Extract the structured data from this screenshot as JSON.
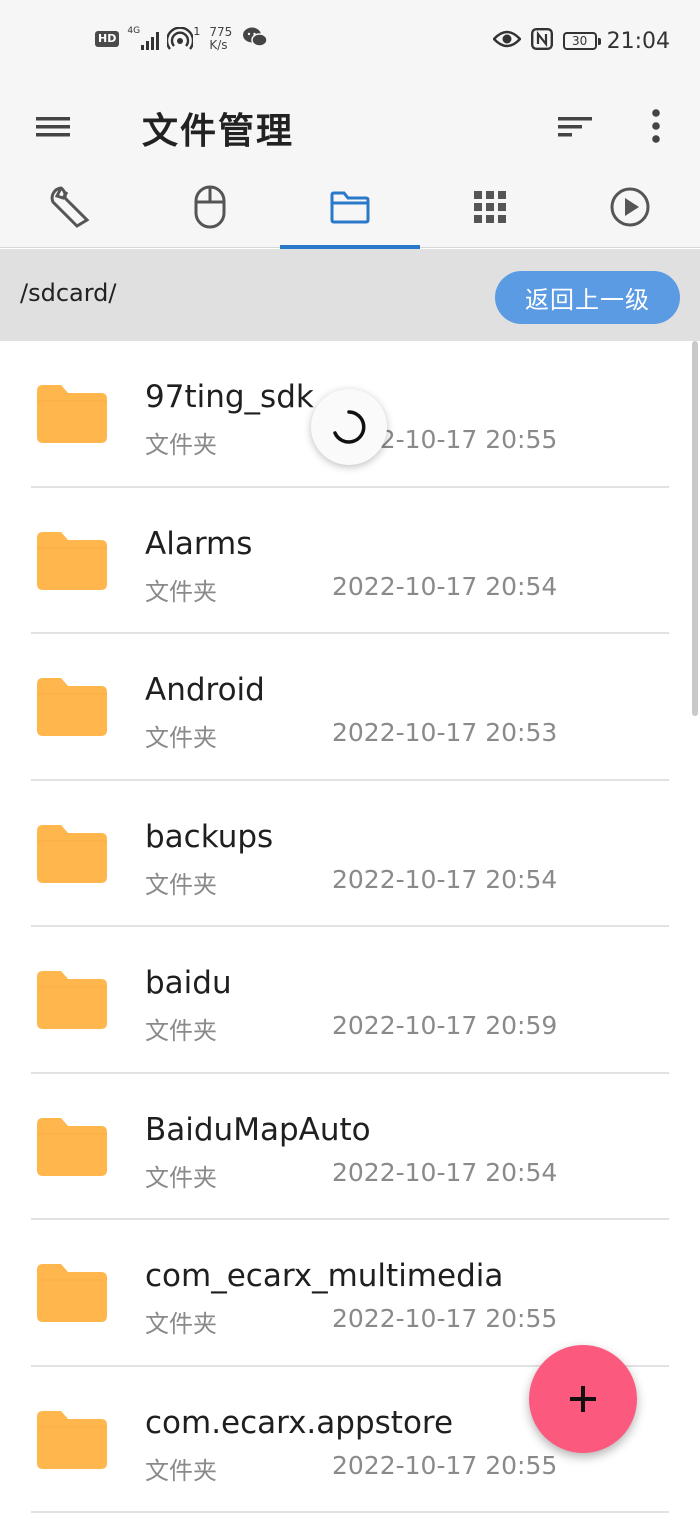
{
  "status_bar": {
    "hd_badge": "HD",
    "network_type": "4G",
    "hotspot_count": "1",
    "speed_value": "775",
    "speed_unit": "K/s",
    "battery_level": "30",
    "time": "21:04",
    "icons": [
      "hd-icon",
      "signal-icon",
      "hotspot-icon",
      "wechat-icon",
      "eye-icon",
      "nfc-icon",
      "battery-icon"
    ]
  },
  "app_bar": {
    "title": "文件管理",
    "icons": [
      "menu-icon",
      "sort-icon",
      "more-vertical-icon"
    ]
  },
  "tabs": [
    {
      "icon": "wrench-icon",
      "active": false
    },
    {
      "icon": "mouse-icon",
      "active": false
    },
    {
      "icon": "folder-icon",
      "active": true
    },
    {
      "icon": "apps-grid-icon",
      "active": false
    },
    {
      "icon": "play-circle-icon",
      "active": false
    }
  ],
  "path_bar": {
    "path": "/sdcard/",
    "back_label": "返回上一级"
  },
  "files": [
    {
      "name": "97ting_sdk",
      "type": "文件夹",
      "date": "2022-10-17 20:55"
    },
    {
      "name": "Alarms",
      "type": "文件夹",
      "date": "2022-10-17 20:54"
    },
    {
      "name": "Android",
      "type": "文件夹",
      "date": "2022-10-17 20:53"
    },
    {
      "name": "backups",
      "type": "文件夹",
      "date": "2022-10-17 20:54"
    },
    {
      "name": "baidu",
      "type": "文件夹",
      "date": "2022-10-17 20:59"
    },
    {
      "name": "BaiduMapAuto",
      "type": "文件夹",
      "date": "2022-10-17 20:54"
    },
    {
      "name": "com_ecarx_multimedia",
      "type": "文件夹",
      "date": "2022-10-17 20:55"
    },
    {
      "name": "com.ecarx.appstore",
      "type": "文件夹",
      "date": "2022-10-17 20:55"
    }
  ],
  "fab": {
    "icon": "plus-icon"
  },
  "colors": {
    "accent": "#2a78c9",
    "back_button": "#5b9be3",
    "fab": "#fb5a7e",
    "folder": "#ffb74d"
  }
}
